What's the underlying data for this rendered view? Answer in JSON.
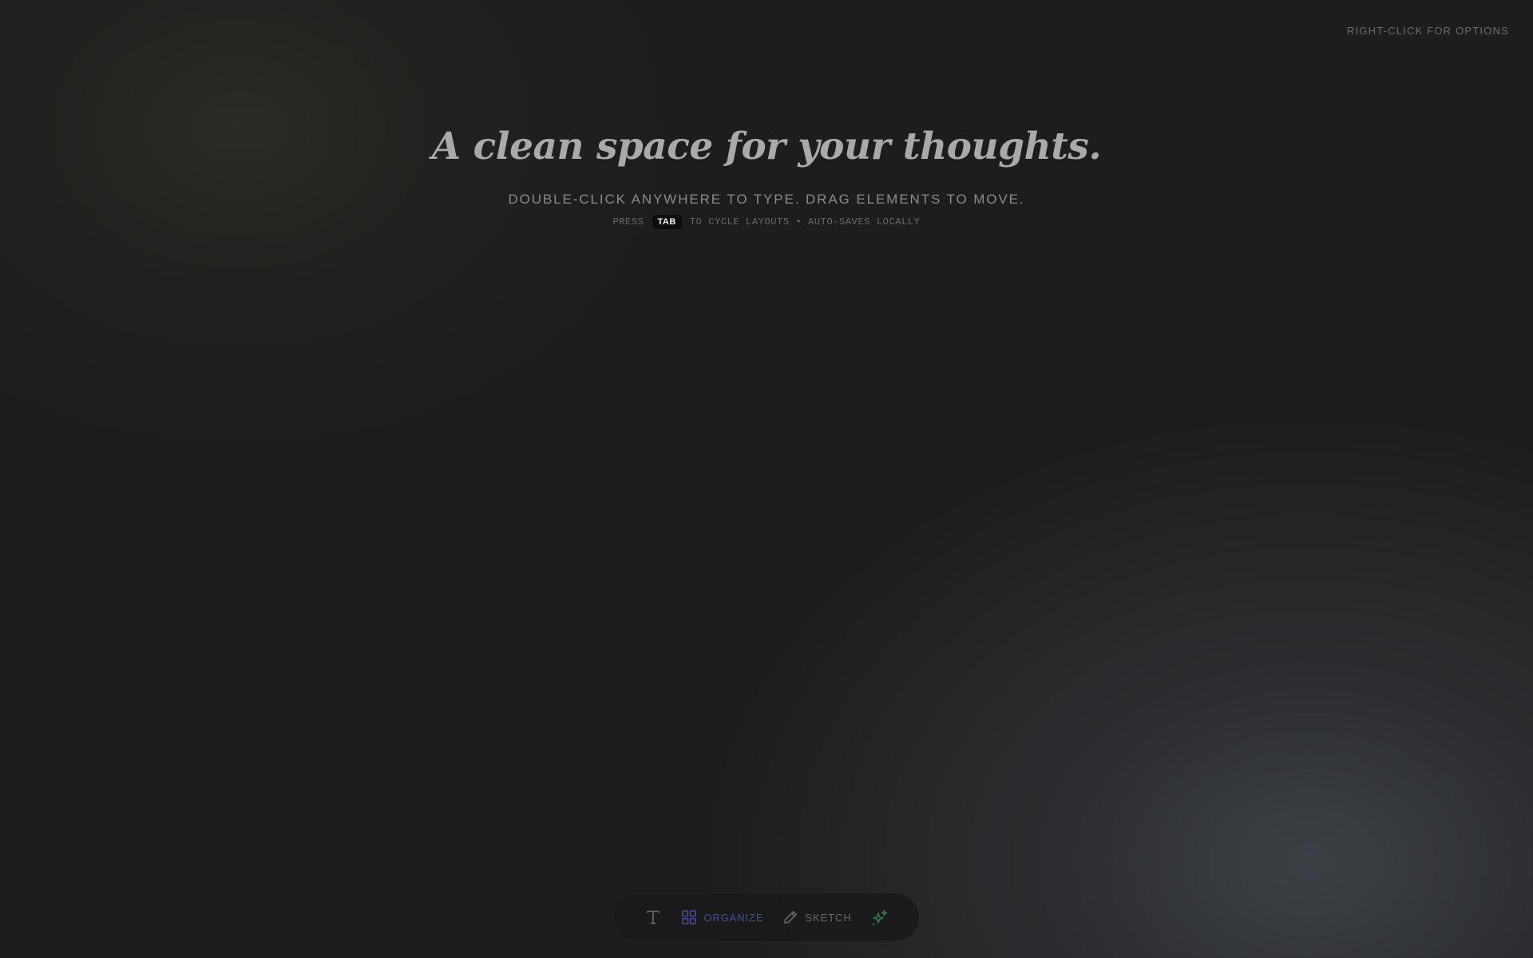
{
  "top_hint": "RIGHT-CLICK FOR OPTIONS",
  "hero": {
    "title": "A clean space for your thoughts.",
    "subtitle": "DOUBLE-CLICK ANYWHERE TO TYPE. DRAG ELEMENTS TO MOVE.",
    "hint_prefix": "PRESS",
    "hint_key": "TAB",
    "hint_suffix": "TO CYCLE LAYOUTS • AUTO-SAVES LOCALLY"
  },
  "toolbar": {
    "items": [
      {
        "name": "text-tool",
        "icon": "text-icon",
        "label": ""
      },
      {
        "name": "organize-tool",
        "icon": "grid-icon",
        "label": "ORGANIZE",
        "active": true
      },
      {
        "name": "sketch-tool",
        "icon": "pencil-icon",
        "label": "SKETCH"
      },
      {
        "name": "ai-tool",
        "icon": "sparkles-icon",
        "label": ""
      }
    ]
  },
  "colors": {
    "background": "#1d1d1d",
    "organize_accent": "#4a4aa0",
    "ai_accent": "#2e7a55",
    "muted_text": "#6b6b6b"
  }
}
